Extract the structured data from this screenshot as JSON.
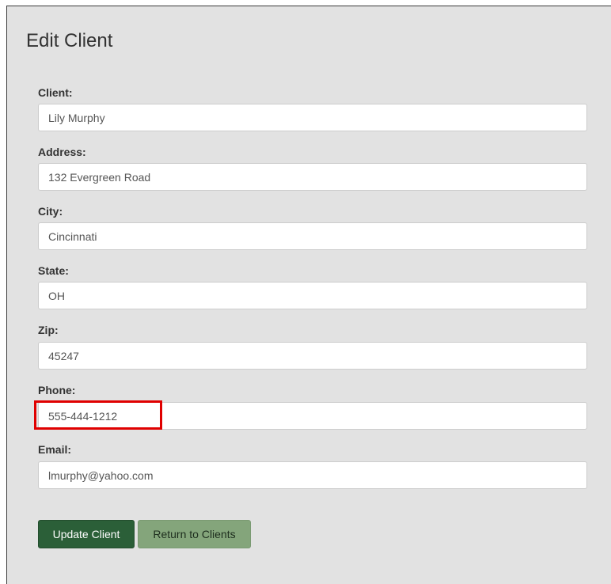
{
  "form": {
    "title": "Edit Client",
    "fields": [
      {
        "label": "Client:",
        "value": "Lily Murphy"
      },
      {
        "label": "Address:",
        "value": "132 Evergreen Road"
      },
      {
        "label": "City:",
        "value": "Cincinnati"
      },
      {
        "label": "State:",
        "value": "OH"
      },
      {
        "label": "Zip:",
        "value": "45247"
      },
      {
        "label": "Phone:",
        "value": "555-444-1212"
      },
      {
        "label": "Email:",
        "value": "lmurphy@yahoo.com"
      }
    ],
    "update_label": "Update Client",
    "return_label": "Return to Clients"
  },
  "colors": {
    "panel_background": "#e2e2e2",
    "primary_button": "#2b5f38",
    "secondary_button": "#84a57b",
    "highlight": "#e00000"
  }
}
